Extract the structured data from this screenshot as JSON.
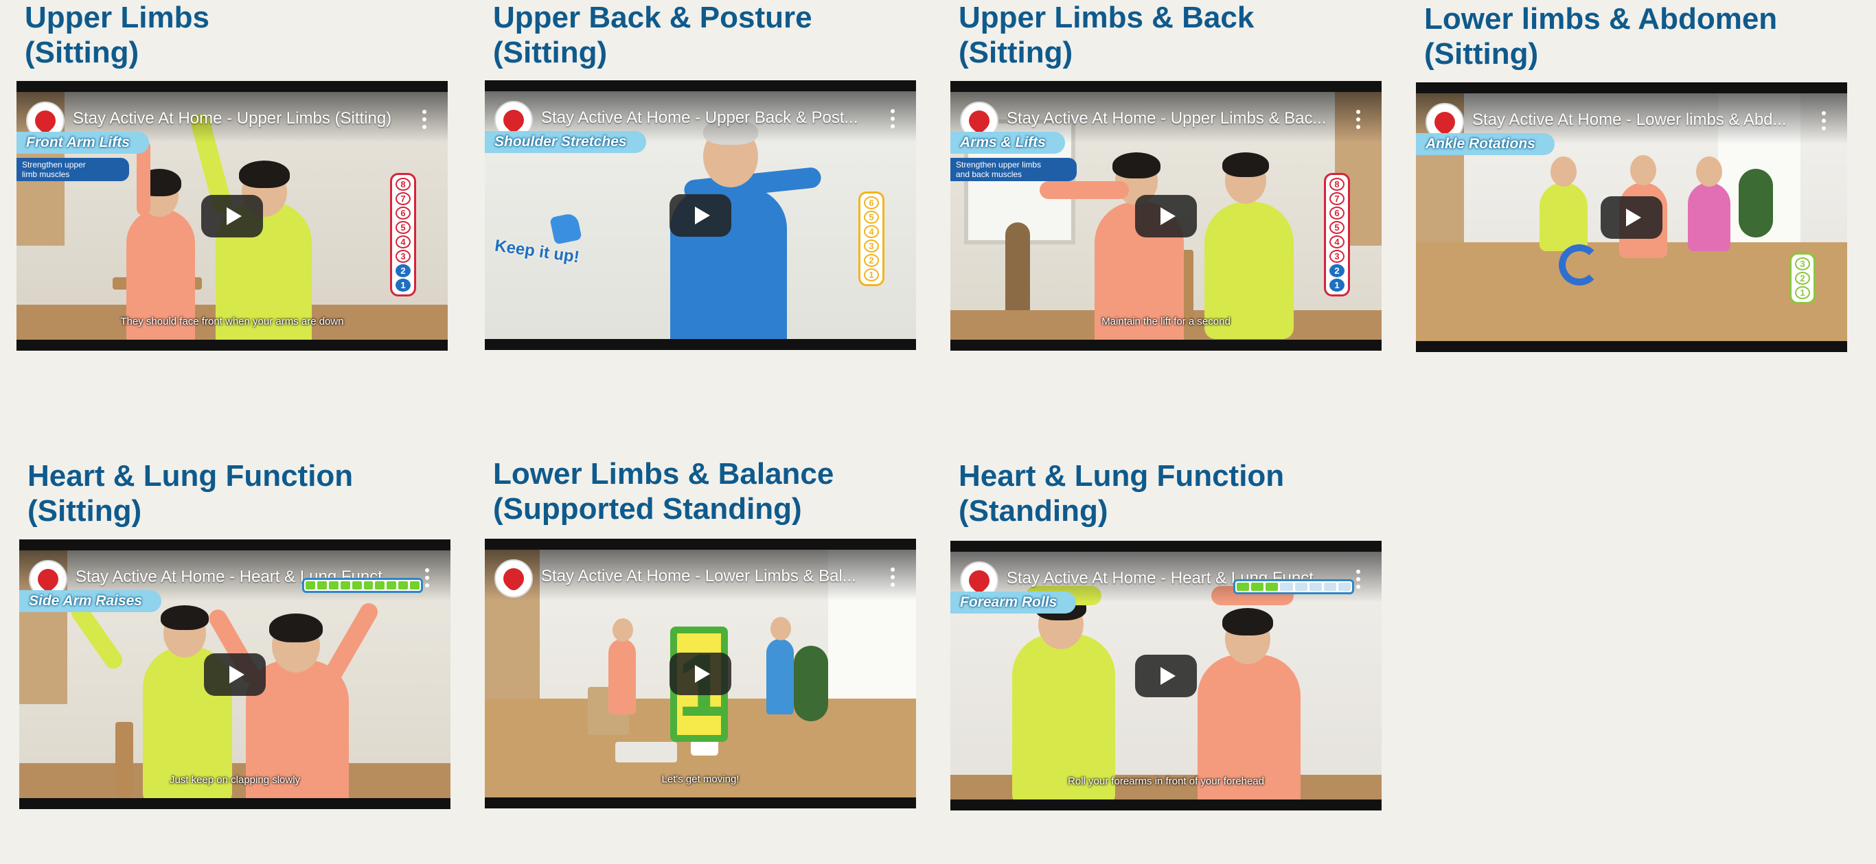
{
  "cards": [
    {
      "heading": "Upper Limbs\n(Sitting)",
      "video_title": "Stay Active At Home - Upper Limbs (Sitting)",
      "segment_label": "Front Arm Lifts",
      "tag": "Strengthen upper\nlimb muscles",
      "caption": "They should face front when your arms are down",
      "counter": [
        "8",
        "7",
        "6",
        "5",
        "4",
        "3",
        "2",
        "1"
      ],
      "counter_done": 2,
      "counter_color": "#d6243b"
    },
    {
      "heading": "Upper Back & Posture\n(Sitting)",
      "video_title": "Stay Active At Home - Upper Back & Post...",
      "segment_label": "Shoulder Stretches",
      "overlay_text": "Keep it up!",
      "counter": [
        "6",
        "5",
        "4",
        "3",
        "2",
        "1"
      ],
      "counter_done": 0,
      "counter_color": "#f2b51d"
    },
    {
      "heading": "Upper Limbs & Back\n(Sitting)",
      "video_title": "Stay Active At Home - Upper Limbs & Bac...",
      "segment_label": "Arms & Lifts",
      "tag": "Strengthen upper limbs\nand back muscles",
      "caption": "Maintain the lift for a second",
      "counter": [
        "8",
        "7",
        "6",
        "5",
        "4",
        "3",
        "2",
        "1"
      ],
      "counter_done": 2,
      "counter_color": "#d6243b"
    },
    {
      "heading": "Lower limbs & Abdomen\n(Sitting)",
      "video_title": "Stay Active At Home - Lower limbs & Abd...",
      "segment_label": "Ankle Rotations",
      "counter": [
        "3",
        "2",
        "1"
      ],
      "counter_done": 0,
      "counter_color": "#8cc63f"
    },
    {
      "heading": "Heart & Lung Function\n(Sitting)",
      "video_title": "Stay Active At Home - Heart & Lung Funct...",
      "segment_label": "Side Arm Raises",
      "caption": "Just keep on clapping slowly",
      "progress_filled": 10,
      "progress_total": 10
    },
    {
      "heading": "Lower Limbs & Balance\n(Supported Standing)",
      "video_title": "Stay Active At Home - Lower Limbs & Bal...",
      "caption": "Let's get moving!",
      "big_number": "1"
    },
    {
      "heading": "Heart & Lung Function\n(Standing)",
      "video_title": "Stay Active At Home - Heart & Lung Funct...",
      "segment_label": "Forearm Rolls",
      "caption": "Roll your forearms in front of your forehead",
      "progress_filled": 3,
      "progress_total": 8
    }
  ],
  "icons": {
    "channel": "channel-logo-icon",
    "menu": "kebab-menu-icon",
    "play": "play-icon"
  },
  "colors": {
    "background": "#f1f0eb",
    "heading": "#0f5a8c",
    "play_button": "#212121"
  }
}
